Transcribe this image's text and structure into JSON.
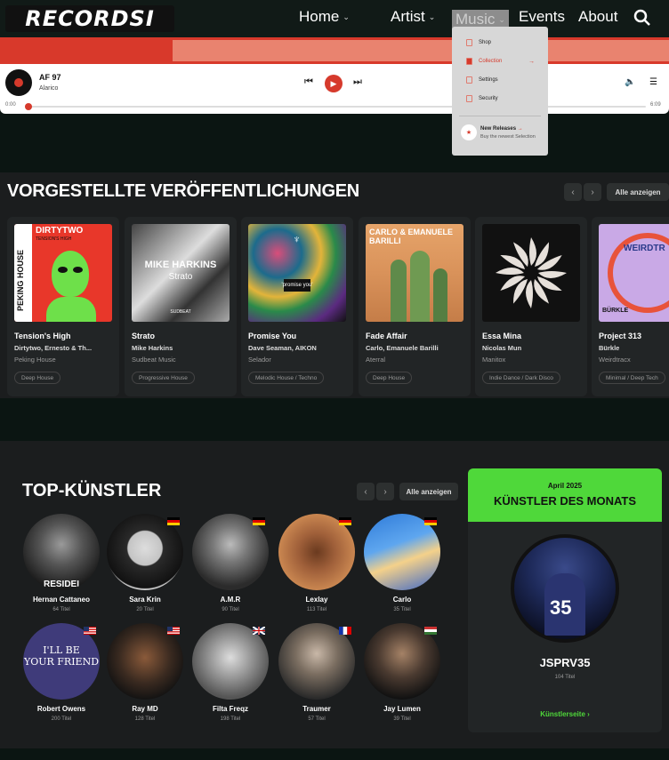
{
  "brand": {
    "logo": "RECORDSI"
  },
  "nav": {
    "items": [
      {
        "label": "Home",
        "has_menu": true
      },
      {
        "label": "Artist",
        "has_menu": true
      },
      {
        "label": "Music",
        "has_menu": true
      },
      {
        "label": "Events",
        "has_menu": false
      },
      {
        "label": "About",
        "has_menu": false
      }
    ]
  },
  "player": {
    "title": "AF 97",
    "artist": "Alarico",
    "time_current": "0:00",
    "time_total": "6:09",
    "progress": 0.0
  },
  "music_menu": {
    "items": [
      "Shop",
      "Collection",
      "Settings",
      "Security"
    ],
    "active": "Collection",
    "promo_title": "New Releases",
    "promo_sub": "Buy the newest Selection"
  },
  "releases": {
    "heading": "VORGESTELLTE VERÖFFENTLICHUNGEN",
    "see_all": "Alle anzeigen",
    "items": [
      {
        "title": "Tension's High",
        "artist": "Dirtytwo, Ernesto & Th...",
        "label": "Peking House",
        "genre": "Deep House",
        "cover_text": "DIRTYTWO"
      },
      {
        "title": "Strato",
        "artist": "Mike Harkins",
        "label": "Sudbeat Music",
        "genre": "Progressive House",
        "cover_text": "MIKE HARKINS"
      },
      {
        "title": "Promise You",
        "artist": "Dave Seaman, AIKON",
        "label": "Selador",
        "genre": "Melodic House / Techno",
        "cover_text": "'promise you'"
      },
      {
        "title": "Fade Affair",
        "artist": "Carlo, Emanuele Barilli",
        "label": "Aterral",
        "genre": "Deep House",
        "cover_text": "CARLO & EMANUELE BARILLI"
      },
      {
        "title": "Essa Mina",
        "artist": "Nicolas Mun",
        "label": "Manitox",
        "genre": "Indie Dance / Dark Disco",
        "cover_text": ""
      },
      {
        "title": "Project 313",
        "artist": "Bürkle",
        "label": "Weirdtracx",
        "genre": "Minimal / Deep Tech",
        "cover_text": "WEIRDTR"
      }
    ]
  },
  "artists": {
    "heading": "TOP-KÜNSTLER",
    "see_all": "Alle anzeigen",
    "items": [
      {
        "name": "Hernan Cattaneo",
        "count": "64 Titel",
        "flag": ""
      },
      {
        "name": "Sara Krin",
        "count": "20 Titel",
        "flag": "de"
      },
      {
        "name": "A.M.R",
        "count": "90 Titel",
        "flag": "de"
      },
      {
        "name": "Lexlay",
        "count": "113 Titel",
        "flag": "de"
      },
      {
        "name": "Carlo",
        "count": "35 Titel",
        "flag": "de"
      },
      {
        "name": "Robert Owens",
        "count": "200 Titel",
        "flag": "us"
      },
      {
        "name": "Ray MD",
        "count": "128 Titel",
        "flag": "us"
      },
      {
        "name": "Filta Freqz",
        "count": "198 Titel",
        "flag": "gb"
      },
      {
        "name": "Traumer",
        "count": "57 Titel",
        "flag": "fr"
      },
      {
        "name": "Jay Lumen",
        "count": "39 Titel",
        "flag": "hu"
      }
    ]
  },
  "artist_of_month": {
    "date": "April 2025",
    "title": "KÜNSTLER DES MONATS",
    "name": "JSPRV35",
    "count": "104 Titel",
    "link": "Künstlerseite"
  },
  "colors": {
    "accent_red": "#d63a2c",
    "accent_green": "#4fd83a",
    "bg": "#0b1512",
    "panel": "#1b1d1e"
  }
}
